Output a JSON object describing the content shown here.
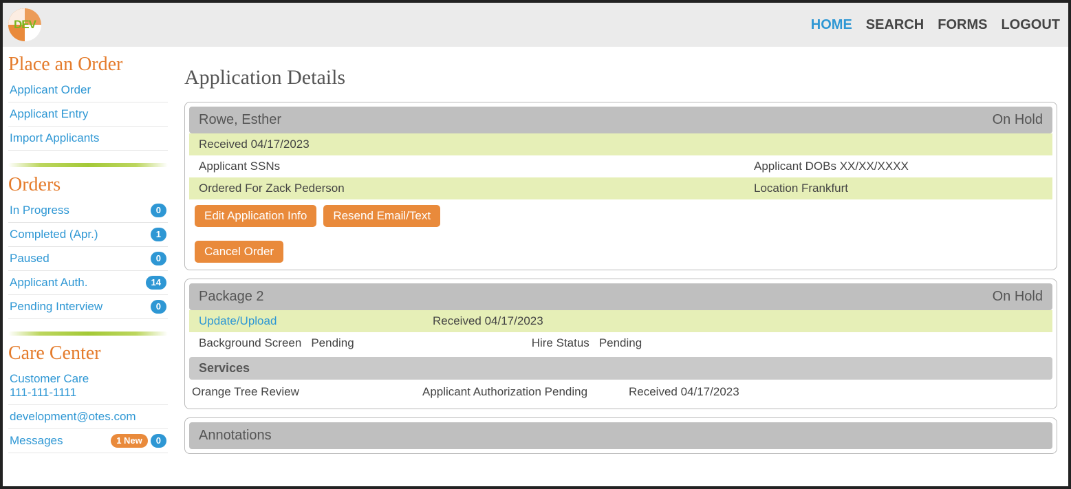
{
  "nav": {
    "home": "HOME",
    "search": "SEARCH",
    "forms": "FORMS",
    "logout": "LOGOUT"
  },
  "logo_text": "DEV",
  "sidebar": {
    "place_order_title": "Place an Order",
    "place_links": {
      "applicant_order": "Applicant Order",
      "applicant_entry": "Applicant Entry",
      "import_applicants": "Import Applicants"
    },
    "orders_title": "Orders",
    "orders": {
      "in_progress": {
        "label": "In Progress",
        "count": "0"
      },
      "completed": {
        "label": "Completed (Apr.)",
        "count": "1"
      },
      "paused": {
        "label": "Paused",
        "count": "0"
      },
      "app_auth": {
        "label": "Applicant Auth.",
        "count": "14"
      },
      "pending_int": {
        "label": "Pending Interview",
        "count": "0"
      }
    },
    "care_title": "Care Center",
    "care": {
      "customer_care": "Customer Care",
      "phone": "111-111-1111",
      "email": "development@otes.com",
      "messages": "Messages",
      "messages_new": "1 New",
      "messages_count": "0"
    }
  },
  "main": {
    "title": "Application Details",
    "applicant_name": "Rowe, Esther",
    "applicant_status": "On Hold",
    "received_label": "Received 04/17/2023",
    "ssn_label": "Applicant SSNs",
    "dob_label": "Applicant DOBs XX/XX/XXXX",
    "ordered_for": "Ordered For Zack Pederson",
    "location": "Location Frankfurt",
    "buttons": {
      "edit": "Edit Application Info",
      "resend": "Resend Email/Text",
      "cancel": "Cancel Order"
    },
    "package": {
      "name": "Package 2",
      "status": "On Hold",
      "update_link": "Update/Upload",
      "received": "Received 04/17/2023",
      "bg_label": "Background Screen",
      "bg_value": "Pending",
      "hire_label": "Hire Status",
      "hire_value": "Pending",
      "services_header": "Services",
      "service_name": "Orange Tree Review",
      "service_status": "Applicant Authorization Pending",
      "service_received": "Received 04/17/2023"
    },
    "annotations_header": "Annotations"
  }
}
